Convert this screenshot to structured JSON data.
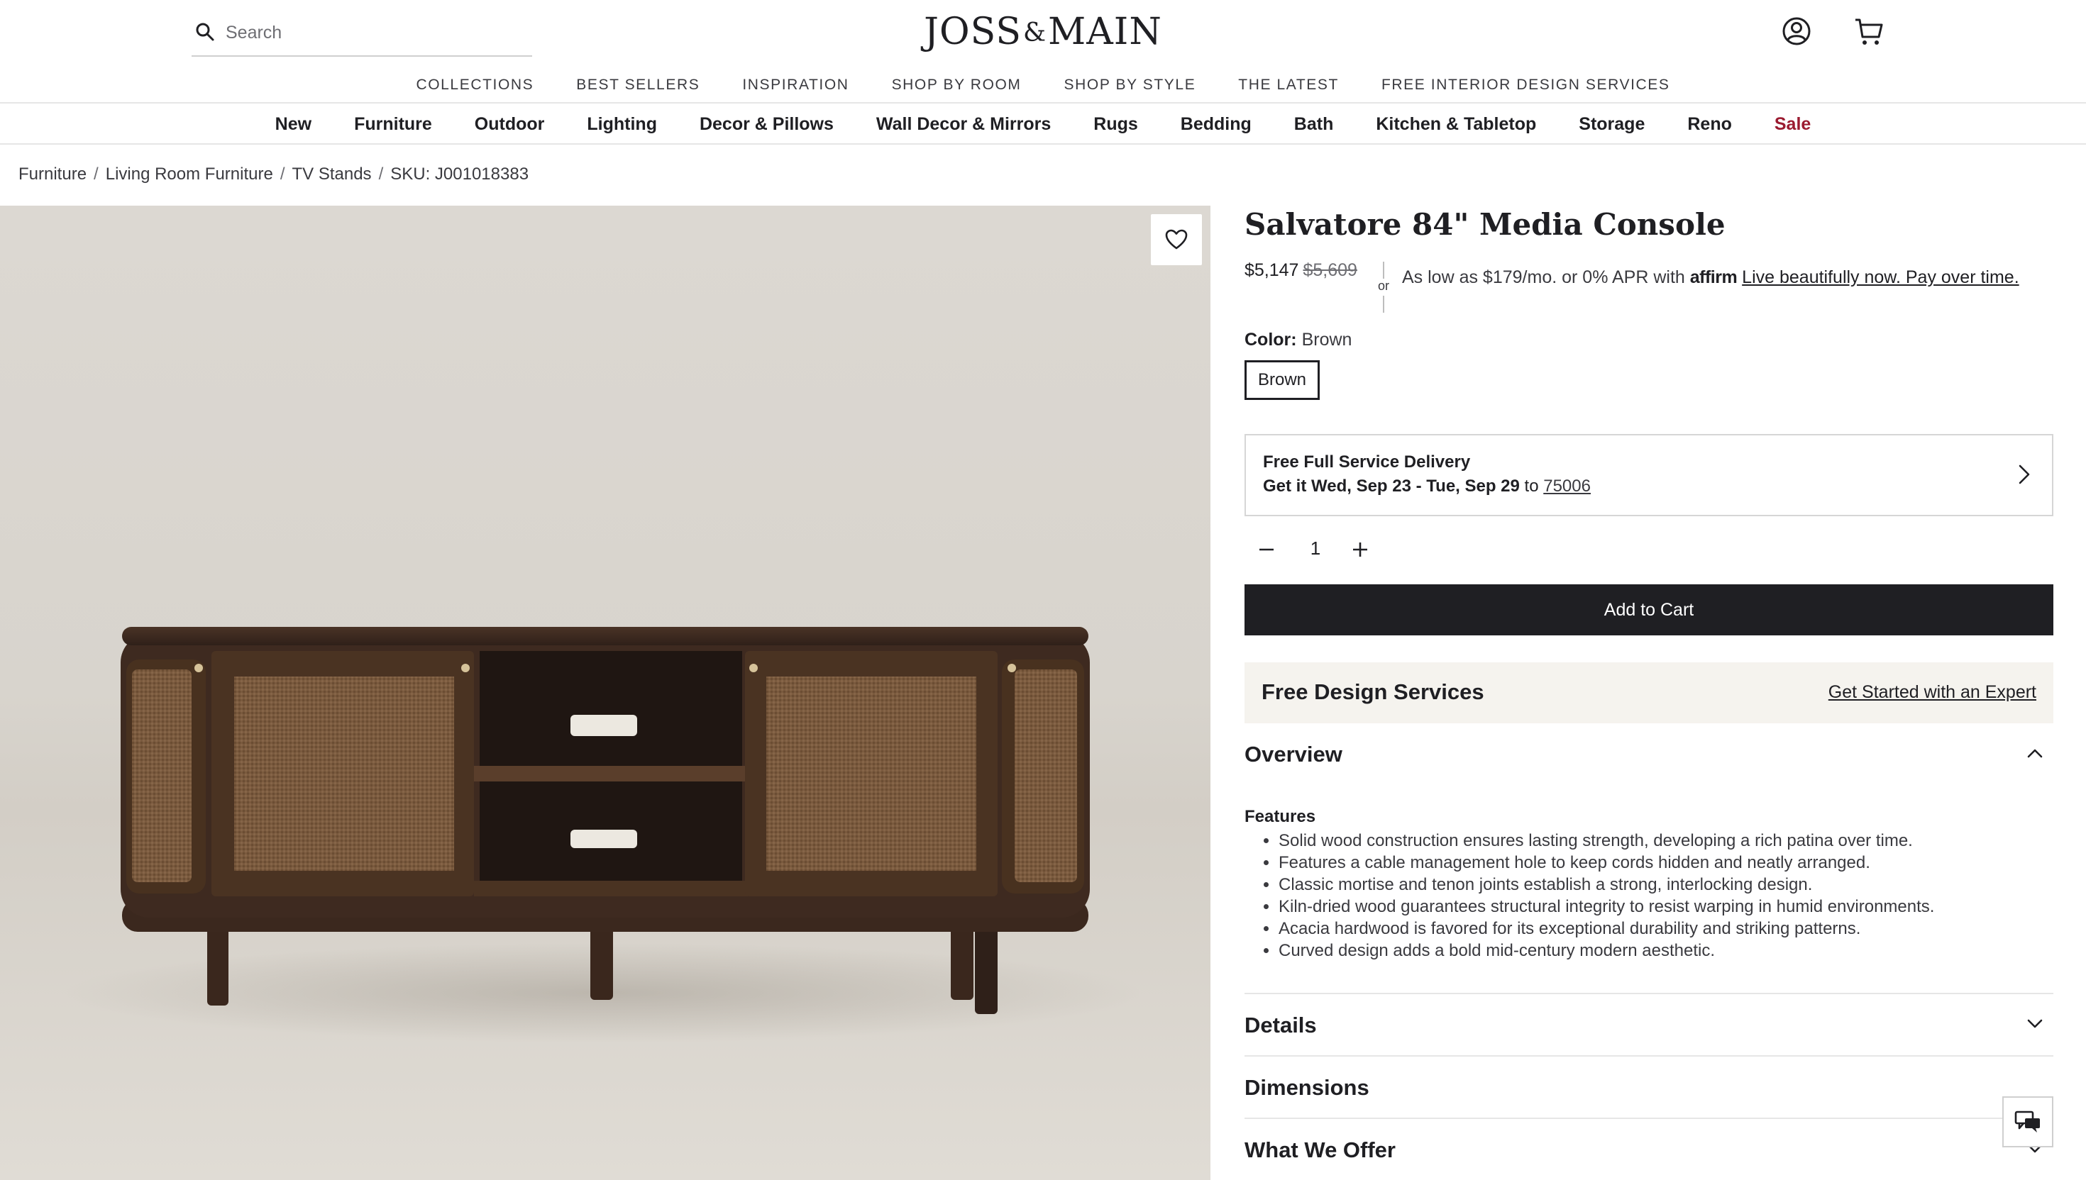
{
  "header": {
    "search_placeholder": "Search",
    "logo_left": "JOSS",
    "logo_amp": "&",
    "logo_right": "MAIN",
    "icons": [
      "search-icon",
      "account-icon",
      "cart-icon"
    ]
  },
  "top_nav": [
    "COLLECTIONS",
    "BEST SELLERS",
    "INSPIRATION",
    "SHOP BY ROOM",
    "SHOP BY STYLE",
    "THE LATEST",
    "FREE INTERIOR DESIGN SERVICES"
  ],
  "category_nav": [
    "New",
    "Furniture",
    "Outdoor",
    "Lighting",
    "Decor & Pillows",
    "Wall Decor & Mirrors",
    "Rugs",
    "Bedding",
    "Bath",
    "Kitchen & Tabletop",
    "Storage",
    "Reno",
    "Sale"
  ],
  "colors": {
    "sale": "#9b1b30",
    "button": "#1f1f23",
    "design_bg": "#f5f3ee"
  },
  "breadcrumb": [
    "Furniture",
    "Living Room Furniture",
    "TV Stands",
    "SKU: J001018383"
  ],
  "product": {
    "title": "Salvatore 84\" Media Console",
    "price": "$5,147",
    "was_price": "$5,609",
    "or": "or",
    "affirm_text": "As low as $179/mo. or 0% APR with",
    "affirm_brand": "affirm",
    "affirm_link": "Live beautifully now. Pay over time.",
    "color_label": "Color:",
    "color_value": "Brown",
    "swatch": "Brown",
    "delivery_title": "Free Full Service Delivery",
    "delivery_dates": "Get it Wed, Sep 23 - Tue, Sep 29",
    "delivery_to": "to",
    "delivery_zip": "75006",
    "quantity": "1",
    "add_to_cart": "Add to Cart",
    "design_title": "Free Design Services",
    "design_link": "Get Started with an Expert"
  },
  "overview": {
    "title": "Overview",
    "features_title": "Features",
    "features": [
      "Solid wood construction ensures lasting strength, developing a rich patina over time.",
      "Features a cable management hole to keep cords hidden and neatly arranged.",
      "Classic mortise and tenon joints establish a strong, interlocking design.",
      "Kiln-dried wood guarantees structural integrity to resist warping in humid environments.",
      "Acacia hardwood is favored for its exceptional durability and striking patterns.",
      "Curved design adds a bold mid-century modern aesthetic."
    ]
  },
  "accordions": [
    "Details",
    "Dimensions",
    "What We Offer"
  ]
}
